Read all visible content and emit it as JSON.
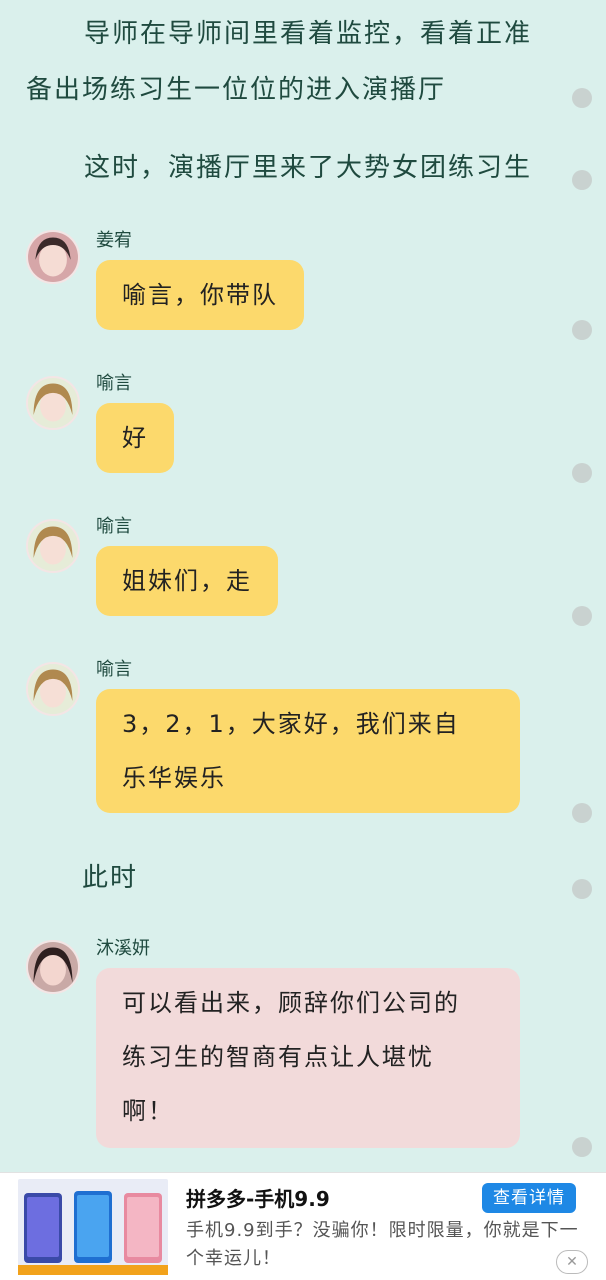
{
  "narration": {
    "intro": "导师在导师间里看着监控，看着正准备出场练习生一位位的进入演播厅",
    "arrival": "这时，演播厅里来了大势女团练习生",
    "meanwhile": "此时"
  },
  "messages": [
    {
      "speaker": "姜宥",
      "lines": [
        "喻言，你带队"
      ],
      "bubble_color": "#fcd96c"
    },
    {
      "speaker": "喻言",
      "lines": [
        "好"
      ],
      "bubble_color": "#fcd96c"
    },
    {
      "speaker": "喻言",
      "lines": [
        "姐妹们，走"
      ],
      "bubble_color": "#fcd96c"
    },
    {
      "speaker": "喻言",
      "lines": [
        "3，2，1，大家好，我们来自",
        "乐华娱乐"
      ],
      "bubble_color": "#fcd96c"
    },
    {
      "speaker": "沐溪妍",
      "lines": [
        "可以看出来，顾辞你们公司的",
        "练习生的智商有点让人堪忧",
        "啊！"
      ],
      "bubble_color": "#f2dada"
    }
  ],
  "ad": {
    "title": "拼多多-手机9.9",
    "cta": "查看详情",
    "description": "手机9.9到手？没骗你！限时限量，你就是下一个幸运儿！",
    "close": "✕"
  },
  "colors": {
    "background": "#daf0ec",
    "yellow_bubble": "#fcd96c",
    "pink_bubble": "#f2dada",
    "cta": "#1e88e5"
  }
}
